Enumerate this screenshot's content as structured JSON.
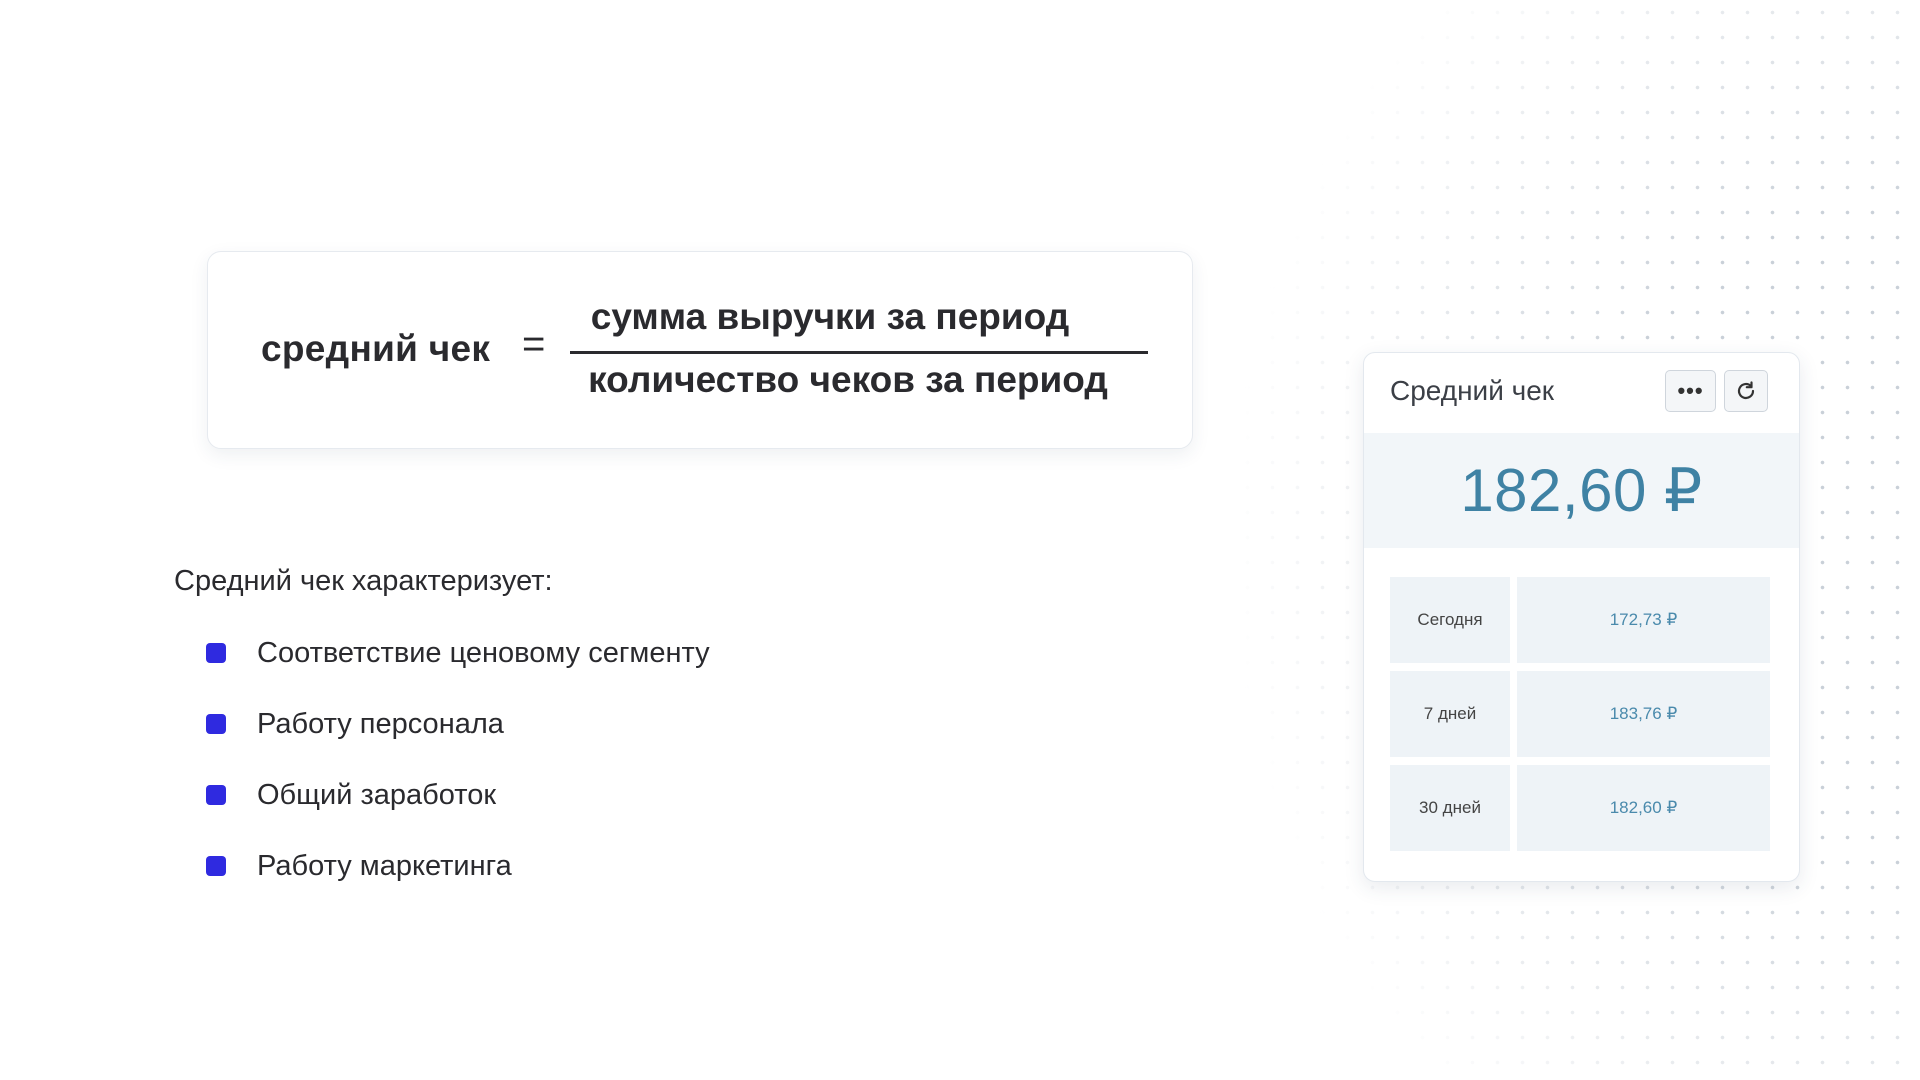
{
  "formula": {
    "left": "средний чек",
    "equals": "=",
    "numerator": "сумма выручки за период",
    "denominator": "количество чеков за период"
  },
  "characteristics": {
    "title": "Средний чек характеризует:",
    "items": [
      "Соответствие ценовому сегменту",
      "Работу персонала",
      "Общий заработок",
      "Работу маркетинга"
    ],
    "bullet_color": "#2f2ae0"
  },
  "widget": {
    "title": "Средний чек",
    "more_icon": "•••",
    "refresh_icon": "refresh-icon",
    "main_value": "182,60 ₽",
    "value_color": "#3f82a4",
    "rows": [
      {
        "period": "Сегодня",
        "value": "172,73 ₽"
      },
      {
        "period": "7 дней",
        "value": "183,76 ₽"
      },
      {
        "period": "30 дней",
        "value": "182,60 ₽"
      }
    ]
  }
}
